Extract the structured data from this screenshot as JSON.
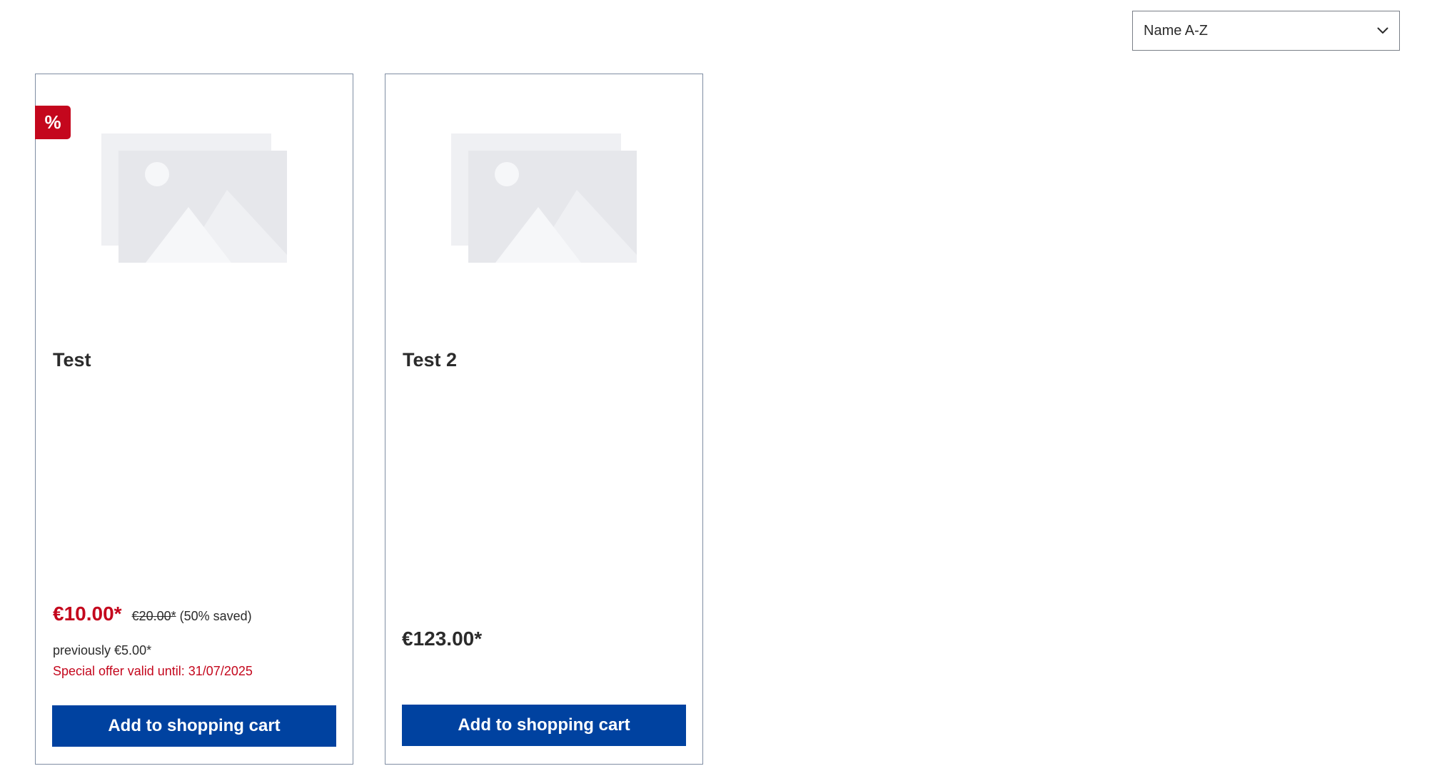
{
  "sort": {
    "selected": "Name A-Z",
    "icon": "chevron-down-icon"
  },
  "products": [
    {
      "title": "Test",
      "badge": "%",
      "price": "€10.00*",
      "list_price": "€20.00*",
      "saved": "(50% saved)",
      "previously": "previously €5.00*",
      "offer": "Special offer valid until: 31/07/2025",
      "button": "Add to shopping cart"
    },
    {
      "title": "Test 2",
      "price": "€123.00*",
      "button": "Add to shopping cart"
    }
  ],
  "colors": {
    "accent_red": "#c4071d",
    "button_blue": "#0042a0"
  }
}
